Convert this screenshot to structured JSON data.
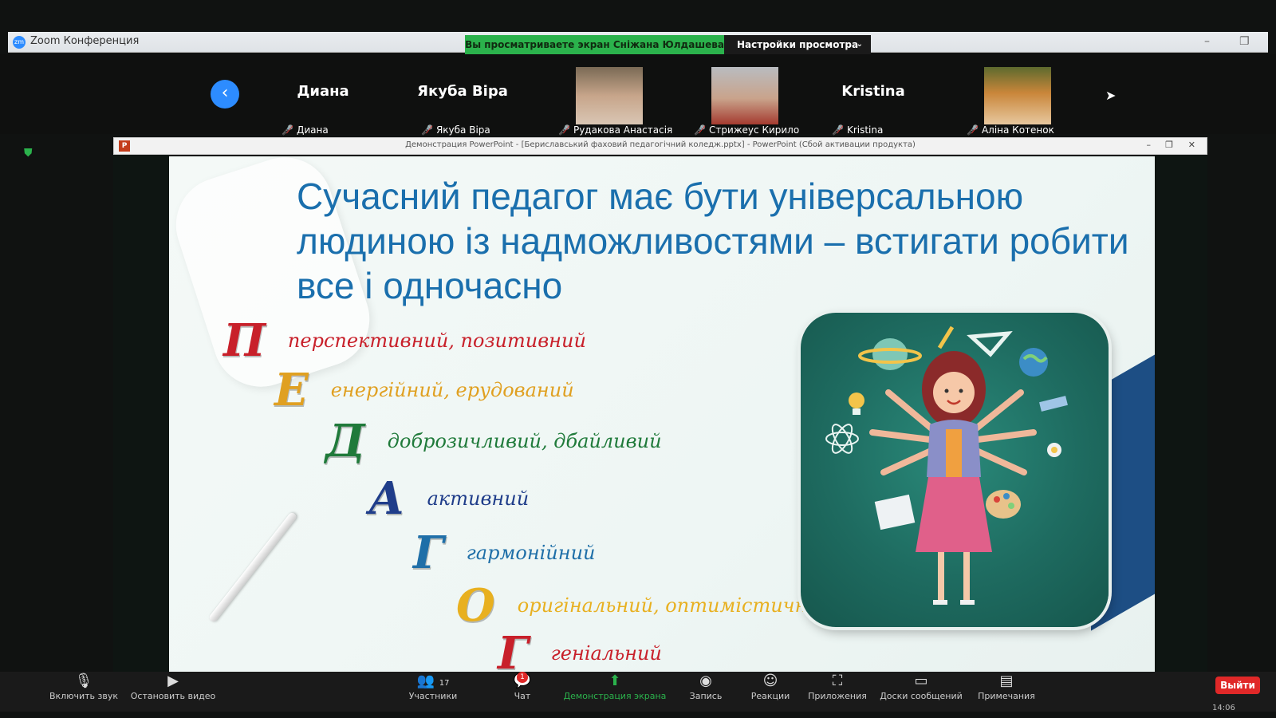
{
  "window": {
    "app_title": "Zoom Конференция",
    "share_banner": "Вы просматриваете экран Сніжана Юлдашева",
    "view_settings": "Настройки просмотра"
  },
  "participants": [
    {
      "big_name": "Диана",
      "label": "Диана",
      "has_video": false
    },
    {
      "big_name": "Якуба Віра",
      "label": "Якуба Віра",
      "has_video": false
    },
    {
      "big_name": "",
      "label": "Рудакова Анастасія",
      "has_video": true
    },
    {
      "big_name": "",
      "label": "Стрижеус Кирило",
      "has_video": true
    },
    {
      "big_name": "Kristina",
      "label": "Kristina",
      "has_video": false
    },
    {
      "big_name": "",
      "label": "Аліна Котенок",
      "has_video": true
    }
  ],
  "powerpoint": {
    "window_title": "Демонстрация PowerPoint - [Бериславський фаховий педагогічний коледж.pptx] - PowerPoint (Сбой активации продукта)"
  },
  "slide": {
    "title": "Сучасний педагог має бути універсальною людиною із надможливостями – встигати робити все і одночасно",
    "acrostic": [
      {
        "letter": "П",
        "words": "перспективний, позитивний",
        "color": "#c8202a"
      },
      {
        "letter": "Е",
        "words": "енергійний, ерудований",
        "color": "#e0a021"
      },
      {
        "letter": "Д",
        "words": "доброзичливий, дбайливий",
        "color": "#1f7a3a"
      },
      {
        "letter": "А",
        "words": "активний",
        "color": "#1f3d8a"
      },
      {
        "letter": "Г",
        "words": "гармонійний",
        "color": "#1f6fa8"
      },
      {
        "letter": "О",
        "words": "оригінальний, оптимістичний",
        "color": "#e8b020"
      },
      {
        "letter": "Г",
        "words": "геніальний",
        "color": "#c8202a"
      }
    ]
  },
  "toolbar": {
    "mute": "Включить звук",
    "video": "Остановить видео",
    "participants": "Участники",
    "participants_count": "17",
    "chat": "Чат",
    "chat_badge": "1",
    "share": "Демонстрация экрана",
    "record": "Запись",
    "reactions": "Реакции",
    "apps": "Приложения",
    "whiteboards": "Доски сообщений",
    "notes": "Примечания",
    "leave": "Выйти",
    "clock": "14:06"
  }
}
